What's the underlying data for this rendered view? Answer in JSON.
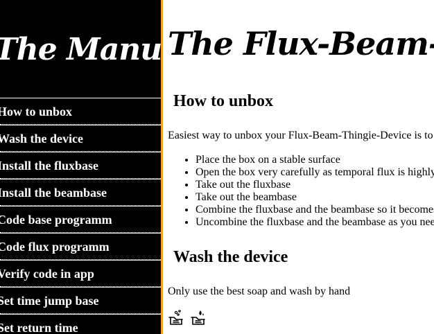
{
  "sidebar": {
    "title": "The Manual",
    "items": [
      {
        "label": "How to unbox"
      },
      {
        "label": "Wash the device"
      },
      {
        "label": "Install the fluxbase"
      },
      {
        "label": "Install the beambase"
      },
      {
        "label": "Code base programm"
      },
      {
        "label": "Code flux programm"
      },
      {
        "label": "Verify code in app"
      },
      {
        "label": "Set time jump base"
      },
      {
        "label": "Set return time"
      }
    ]
  },
  "main": {
    "title": "The Flux-Beam-Thingie-Device",
    "sections": [
      {
        "heading": "How to unbox",
        "intro": "Easiest way to unbox your Flux-Beam-Thingie-Device is to",
        "steps": [
          "Place the box on a stable surface",
          "Open the box very carefully as temporal flux is highly",
          "Take out the fluxbase",
          "Take out the beambase",
          "Combine the fluxbase and the beambase so it becomes",
          "Uncombine the fluxbase and the beambase as you need"
        ]
      },
      {
        "heading": "Wash the device",
        "intro": "Only use the best soap and wash by hand",
        "icons": [
          "hand-washing-icon",
          "soap-bubbles-icon"
        ]
      }
    ]
  },
  "colors": {
    "sidebar_bg": "#000000",
    "sidebar_text": "#ffffff",
    "accent_border": "#f0a020",
    "main_bg": "#ffffff",
    "main_text": "#000000"
  }
}
